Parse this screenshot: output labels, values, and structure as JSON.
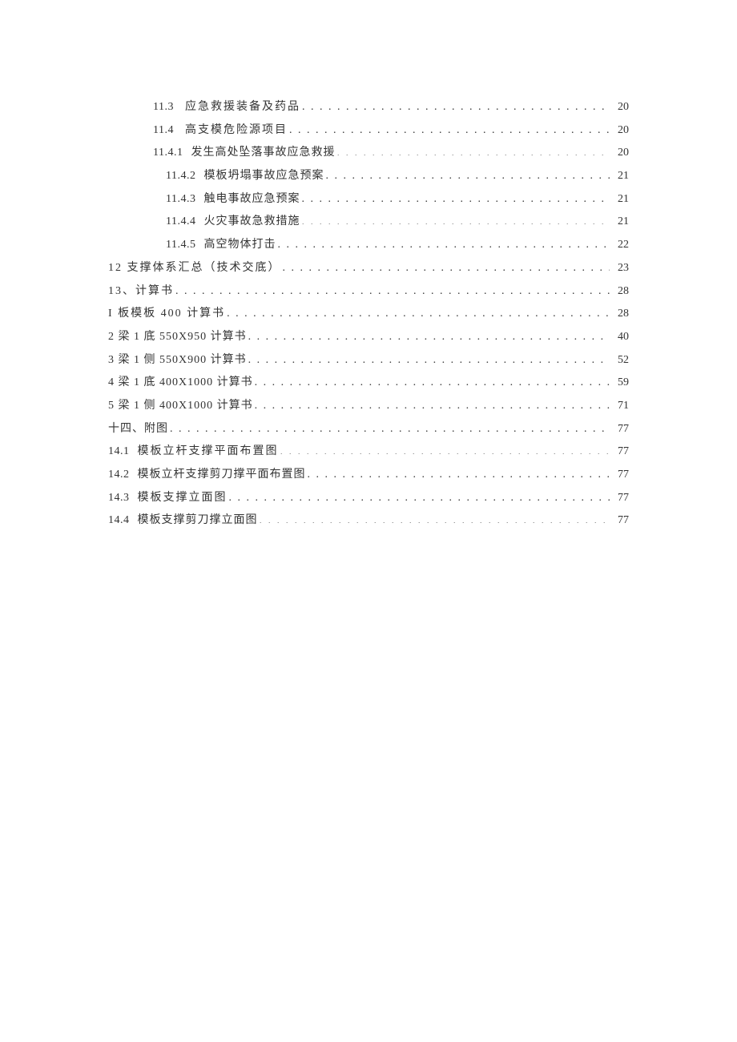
{
  "toc": [
    {
      "indent": 1,
      "num": "11.3",
      "gap": "lg",
      "title": "应急救援装备及药品",
      "page": "20",
      "sp": true
    },
    {
      "indent": 1,
      "num": "11.4",
      "gap": "lg",
      "title": "高支模危险源项目",
      "page": "20",
      "sp": true
    },
    {
      "indent": 1,
      "num": "11.4.1",
      "gap": "sm",
      "title": "发生高处坠落事故应急救援",
      "page": "20",
      "sp": false
    },
    {
      "indent": 2,
      "num": "11.4.2",
      "gap": "sm",
      "title": "模板坍塌事故应急预案",
      "page": "21",
      "sp": false
    },
    {
      "indent": 2,
      "num": "11.4.3",
      "gap": "sm",
      "title": "触电事故应急预案",
      "page": "21",
      "sp": false
    },
    {
      "indent": 2,
      "num": "11.4.4",
      "gap": "sm",
      "title": "火灾事故急救措施",
      "page": "21",
      "sp": false
    },
    {
      "indent": 2,
      "num": "11.4.5",
      "gap": "sm",
      "title": "高空物体打击",
      "page": "22",
      "sp": false
    },
    {
      "indent": 0,
      "num": "",
      "gap": "",
      "title": "12 支撑体系汇总（技术交底）",
      "page": "23",
      "sp": true
    },
    {
      "indent": 0,
      "num": "",
      "gap": "",
      "title": "13、计算书",
      "page": "28",
      "sp": true
    },
    {
      "indent": 0,
      "num": "",
      "gap": "",
      "title": "I 板模板 400 计算书",
      "page": "28",
      "sp": true
    },
    {
      "indent": 0,
      "num": "",
      "gap": "",
      "title": "2 梁 1 底 550X950 计算书",
      "page": "40",
      "sp": false
    },
    {
      "indent": 0,
      "num": "",
      "gap": "",
      "title": "3 梁 1 侧 550X900 计算书",
      "page": "52",
      "sp": false
    },
    {
      "indent": 0,
      "num": "",
      "gap": "",
      "title": "4 梁 1 底 400X1000 计算书",
      "page": "59",
      "sp": false
    },
    {
      "indent": 0,
      "num": "",
      "gap": "",
      "title": "5 梁 1 侧 400X1000 计算书",
      "page": "71",
      "sp": false
    },
    {
      "indent": 0,
      "num": "",
      "gap": "",
      "title": "十四、附图",
      "page": "77",
      "sp": false
    },
    {
      "indent": 0,
      "num": "14.1",
      "gap": "sm",
      "title": "模板立杆支撑平面布置图",
      "page": "77",
      "sp": true
    },
    {
      "indent": 0,
      "num": "14.2",
      "gap": "sm",
      "title": "模板立杆支撑剪刀撑平面布置图",
      "page": "77",
      "sp": false
    },
    {
      "indent": 0,
      "num": "14.3",
      "gap": "sm",
      "title": "模板支撑立面图",
      "page": "77",
      "sp": true
    },
    {
      "indent": 0,
      "num": "14.4",
      "gap": "sm",
      "title": "模板支撑剪刀撑立面图",
      "page": "77",
      "sp": false
    }
  ]
}
